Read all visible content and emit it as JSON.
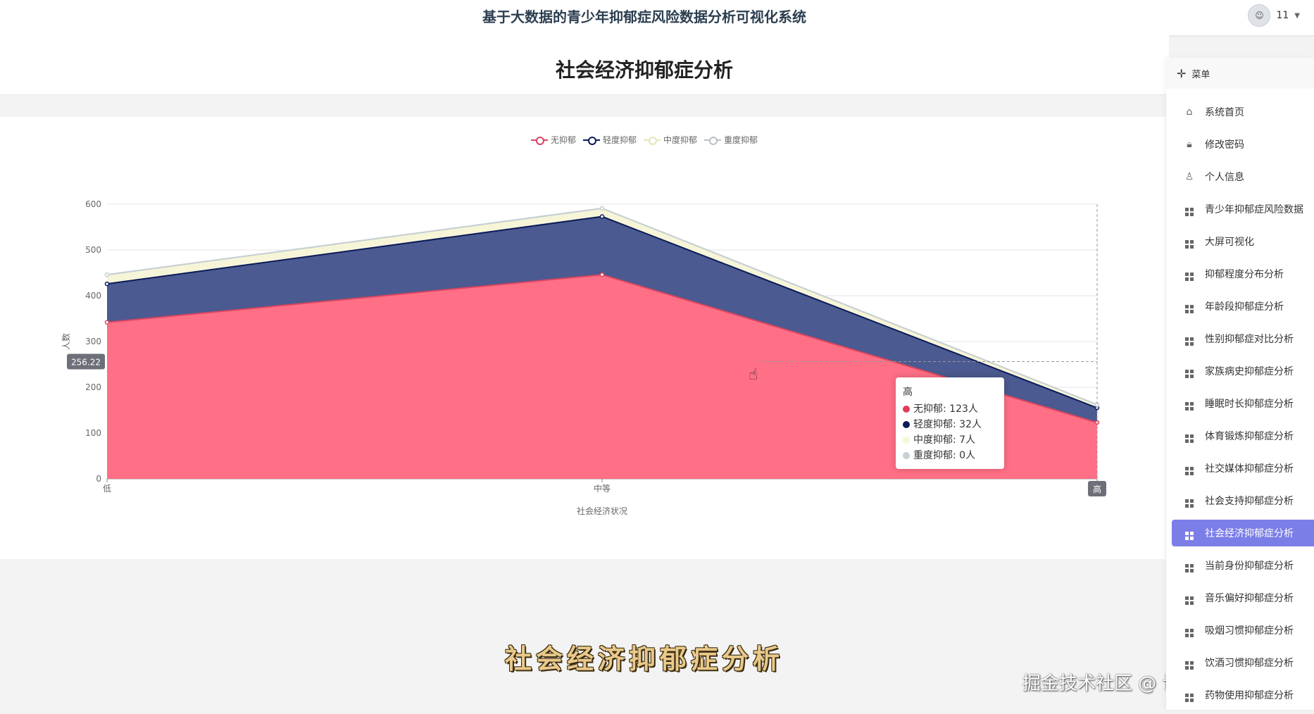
{
  "app": {
    "title": "基于大数据的青少年抑郁症风险数据分析可视化系统",
    "user_name": "11"
  },
  "page": {
    "title": "社会经济抑郁症分析"
  },
  "sidebar": {
    "header": "菜单",
    "items": [
      {
        "label": "系统首页",
        "icon": "home-icon"
      },
      {
        "label": "修改密码",
        "icon": "lock-icon"
      },
      {
        "label": "个人信息",
        "icon": "user-icon"
      },
      {
        "label": "青少年抑郁症风险数据",
        "icon": "grid-icon"
      },
      {
        "label": "大屏可视化",
        "icon": "grid-icon"
      },
      {
        "label": "抑郁程度分布分析",
        "icon": "grid-icon"
      },
      {
        "label": "年龄段抑郁症分析",
        "icon": "grid-icon"
      },
      {
        "label": "性别抑郁症对比分析",
        "icon": "grid-icon"
      },
      {
        "label": "家族病史抑郁症分析",
        "icon": "grid-icon"
      },
      {
        "label": "睡眠时长抑郁症分析",
        "icon": "grid-icon"
      },
      {
        "label": "体育锻炼抑郁症分析",
        "icon": "grid-icon"
      },
      {
        "label": "社交媒体抑郁症分析",
        "icon": "grid-icon"
      },
      {
        "label": "社会支持抑郁症分析",
        "icon": "grid-icon"
      },
      {
        "label": "社会经济抑郁症分析",
        "icon": "grid-icon",
        "active": true
      },
      {
        "label": "当前身份抑郁症分析",
        "icon": "grid-icon"
      },
      {
        "label": "音乐偏好抑郁症分析",
        "icon": "grid-icon"
      },
      {
        "label": "吸烟习惯抑郁症分析",
        "icon": "grid-icon"
      },
      {
        "label": "饮酒习惯抑郁症分析",
        "icon": "grid-icon"
      },
      {
        "label": "药物使用抑郁症分析",
        "icon": "grid-icon"
      }
    ]
  },
  "chart_data": {
    "type": "area",
    "stacked": true,
    "categories": [
      "低",
      "中等",
      "高"
    ],
    "series": [
      {
        "name": "无抑郁",
        "values": [
          342,
          446,
          123
        ],
        "color": "#ff6f85"
      },
      {
        "name": "轻度抑郁",
        "values": [
          84,
          127,
          32
        ],
        "color": "#0b1b5a"
      },
      {
        "name": "中度抑郁",
        "values": [
          20,
          18,
          7
        ],
        "color": "#f7f5d8"
      },
      {
        "name": "重度抑郁",
        "values": [
          0,
          0,
          0
        ],
        "color": "#c5cfd4"
      }
    ],
    "xlabel": "社会经济状况",
    "ylabel": "人数",
    "ylim": [
      0,
      600
    ],
    "yticks": [
      0,
      100,
      200,
      300,
      400,
      500,
      600
    ],
    "legend_position": "top-center",
    "grid": true,
    "pointer_label": "256.22",
    "axis_pointer_category": "高",
    "tooltip": {
      "title": "高",
      "rows": [
        {
          "text": "无抑郁: 123人",
          "color": "#e23c58"
        },
        {
          "text": "轻度抑郁: 32人",
          "color": "#0b1b5a"
        },
        {
          "text": "中度抑郁: 7人",
          "color": "#f7f5d8"
        },
        {
          "text": "重度抑郁: 0人",
          "color": "#c5cfd4"
        }
      ]
    }
  },
  "overlay": {
    "video_caption": "社会经济抑郁症分析",
    "credit_text": "掘金技术社区 @ 计算机毕设指导师"
  }
}
